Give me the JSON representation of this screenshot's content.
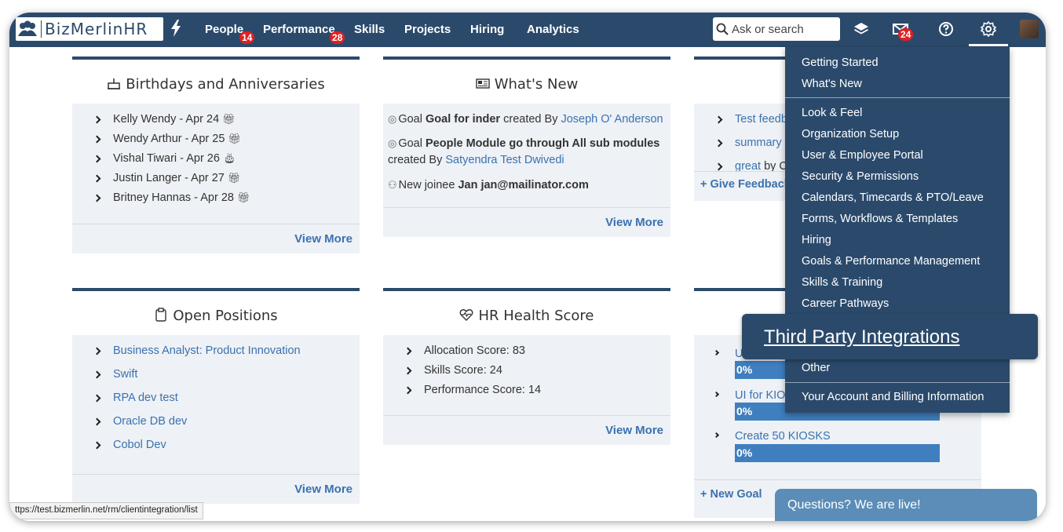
{
  "brand": {
    "name": "BizMerlinHR"
  },
  "nav": {
    "people": {
      "label": "People",
      "badge": "14"
    },
    "performance": {
      "label": "Performance",
      "badge": "28"
    },
    "skills": "Skills",
    "projects": "Projects",
    "hiring": "Hiring",
    "analytics": "Analytics"
  },
  "search": {
    "placeholder": "Ask or search"
  },
  "inbox_badge": "24",
  "birthdays": {
    "title": "Birthdays and Anniversaries",
    "items": [
      "Kelly Wendy - Apr 24",
      "Wendy Arthur - Apr 25",
      "Vishal Tiwari - Apr 26",
      "Justin Langer - Apr 27",
      "Britney Hannas - Apr 28"
    ],
    "view_more": "View More"
  },
  "whats_new": {
    "title": "What's New",
    "goal1": {
      "prefix": "Goal",
      "name": "Goal for inder",
      "mid": "created By",
      "by": "Joseph O' Anderson"
    },
    "goal2": {
      "prefix": "Goal",
      "name": "People Module go through All sub modules",
      "mid": "created By",
      "by": "Satyendra Test Dwivedi"
    },
    "joinee": {
      "prefix": "New joinee",
      "name": "Jan jan@mailinator.com"
    },
    "view_more": "View More"
  },
  "feedback": {
    "items": [
      "Test feedb",
      "summary",
      "great"
    ],
    "by_suffix": "by C",
    "give_feedback": "+ Give Feedback"
  },
  "open_positions": {
    "title": "Open Positions",
    "items": [
      "Business Analyst: Product Innovation",
      "Swift",
      "RPA dev test",
      "Oracle DB dev",
      "Cobol Dev"
    ],
    "view_more": "View More"
  },
  "hr_health": {
    "title": "HR Health Score",
    "items": [
      "Allocation Score: 83",
      "Skills Score: 24",
      "Performance Score: 14"
    ],
    "view_more": "View More"
  },
  "goals": {
    "items": [
      {
        "label": "U",
        "progress": "0%"
      },
      {
        "label": "UI for KIO",
        "progress": "0%"
      },
      {
        "label": "Create 50 KIOSKS",
        "progress": "0%"
      }
    ],
    "new_goal": "+ New Goal"
  },
  "settings_menu": {
    "items": [
      "Getting Started",
      "What's New",
      "Look & Feel",
      "Organization Setup",
      "User & Employee Portal",
      "Security & Permissions",
      "Calendars, Timecards & PTO/Leave",
      "Forms, Workflows & Templates",
      "Hiring",
      "Goals & Performance Management",
      "Skills & Training",
      "Career Pathways",
      "Other",
      "Your Account and Billing Information"
    ],
    "highlight": "Third Party Integrations"
  },
  "status_url": "ttps://test.bizmerlin.net/rm/clientintegration/list",
  "chat": {
    "label": "Questions? We are live!"
  }
}
